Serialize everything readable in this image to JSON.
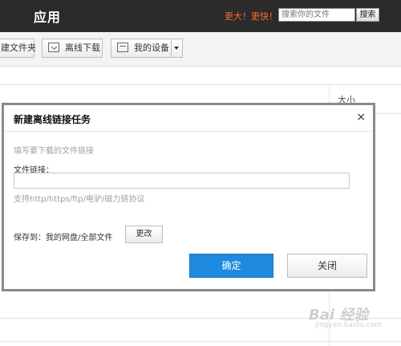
{
  "topbar": {
    "app_title": "应用",
    "promo": "更大！更快！",
    "search_placeholder": "搜索你的文件",
    "search_button": "搜索"
  },
  "toolbar": {
    "new_folder": "建文件夹",
    "offline_download": "离线下载",
    "my_devices": "我的设备"
  },
  "table": {
    "size_header": "大小"
  },
  "dialog": {
    "title": "新建离线链接任务",
    "close_glyph": "×",
    "hint": "填写要下载的文件链接",
    "field_label": "文件链接：",
    "url_value": "",
    "protocol_hint": "支持http/https/ftp/电驴/磁力链协议",
    "save_to_label": "保存到：我的网盘/全部文件",
    "change_button": "更改",
    "ok_button": "确定",
    "close_button": "关闭"
  },
  "watermark": {
    "text": "Bai 经验",
    "url": "jingyan.baidu.com"
  },
  "colors": {
    "topbar_bg": "#2b2b2b",
    "promo": "#ff6a2a",
    "primary_button": "#1e8be0"
  }
}
